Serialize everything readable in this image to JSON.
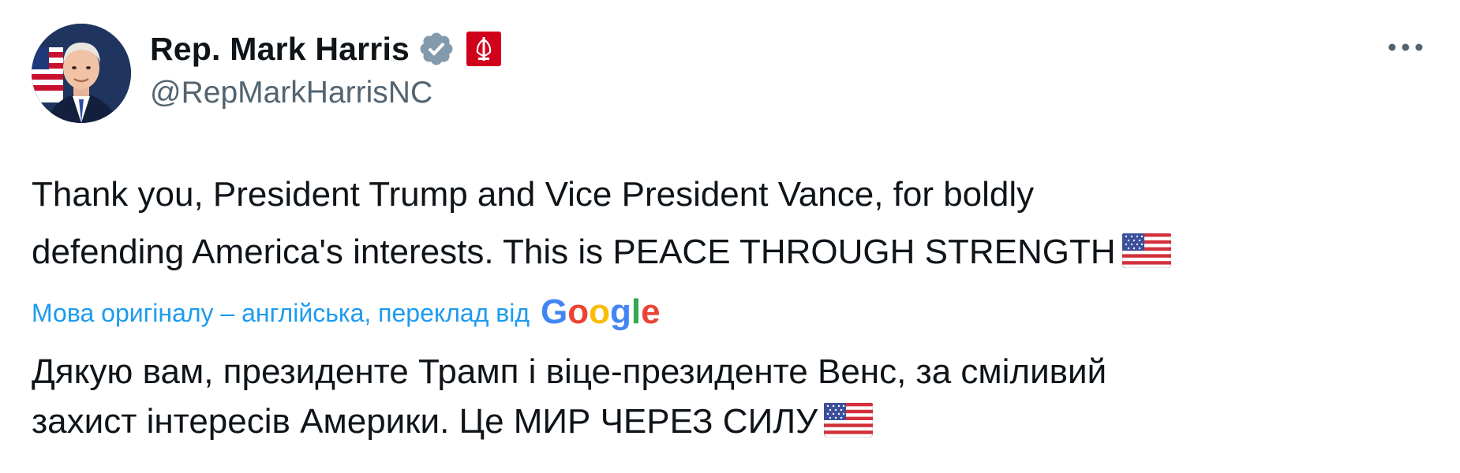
{
  "author": {
    "display_name": "Rep. Mark Harris",
    "handle": "@RepMarkHarrisNC",
    "avatar_icon": "profile-photo",
    "verified_icon": "verified-badge-icon",
    "affiliate_icon": "house-seal-icon"
  },
  "menu": {
    "more_icon": "more-dots-icon"
  },
  "tweet": {
    "line1": "Thank you, President Trump and Vice President Vance, for boldly",
    "line2": "defending America's interests. This is PEACE THROUGH STRENGTH",
    "flag_emoji": "us-flag-emoji"
  },
  "translation": {
    "label": "Мова оригіналу – англійська, переклад від",
    "provider_logo": "Google",
    "line1": "Дякую вам, президенте Трамп і віце-президенте Венс, за сміливий",
    "line2": "захист інтересів Америки. Це МИР ЧЕРЕЗ СИЛУ"
  },
  "colors": {
    "text": "#0f1419",
    "secondary": "#536471",
    "link": "#1d9bf0",
    "verified": "#829aab",
    "seal": "#d0021b"
  }
}
